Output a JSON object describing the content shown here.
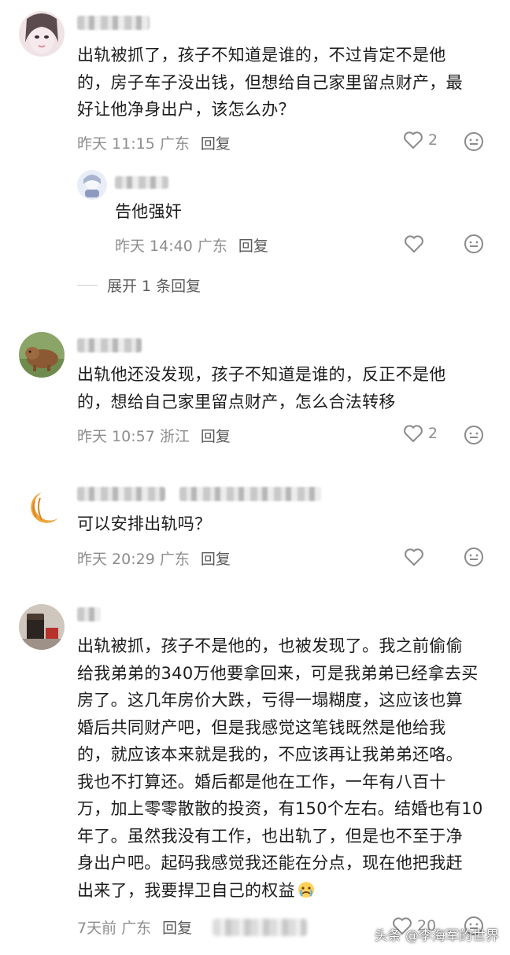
{
  "comments": [
    {
      "text": "出轨被抓了，孩子不知道是谁的，不过肯定不是他\n的，房子车子没出钱，但想给自己家里留点财产，最\n好让他净身出户，该怎么办？",
      "time": "昨天 11:15 广东",
      "reply_label": "回复",
      "likes": "2",
      "reply": {
        "text": "告他强奸",
        "time": "昨天 14:40 广东",
        "reply_label": "回复"
      },
      "expand_label": "展开 1 条回复"
    },
    {
      "text": "出轨他还没发现，孩子不知道是谁的，反正不是他\n的，想给自己家里留点财产，怎么合法转移",
      "time": "昨天 10:57 浙江",
      "reply_label": "回复",
      "likes": "2"
    },
    {
      "text": "可以安排出轨吗？",
      "time": "昨天 20:29 广东",
      "reply_label": "回复"
    },
    {
      "text": "出轨被抓，孩子不是他的，也被发现了。我之前偷偷\n给我弟弟的340万他要拿回来，可是我弟弟已经拿去买\n房了。这几年房价大跌，亏得一塌糊度，这应该也算\n婚后共同财产吧，但是我感觉这笔钱既然是他给我\n的，就应该本来就是我的，不应该再让我弟弟还咯。\n我也不打算还。婚后都是他在工作，一年有八百十\n万，加上零零散散的投资，有150个左右。结婚也有10\n年了。虽然我没有工作，也出轨了，但是也不至于净\n身出户吧。起码我感觉我还能在分点，现在他把我赶\n出来了，我要捍卫自己的权益",
      "time": "7天前 广东",
      "reply_label": "回复",
      "likes": "20"
    }
  ],
  "watermark": "头条 @李海军的世界",
  "icons": {
    "like": "heart-outline-icon",
    "emoji": "smiley-face-icon",
    "tearful_emoji": "tearful-emoji-icon"
  }
}
